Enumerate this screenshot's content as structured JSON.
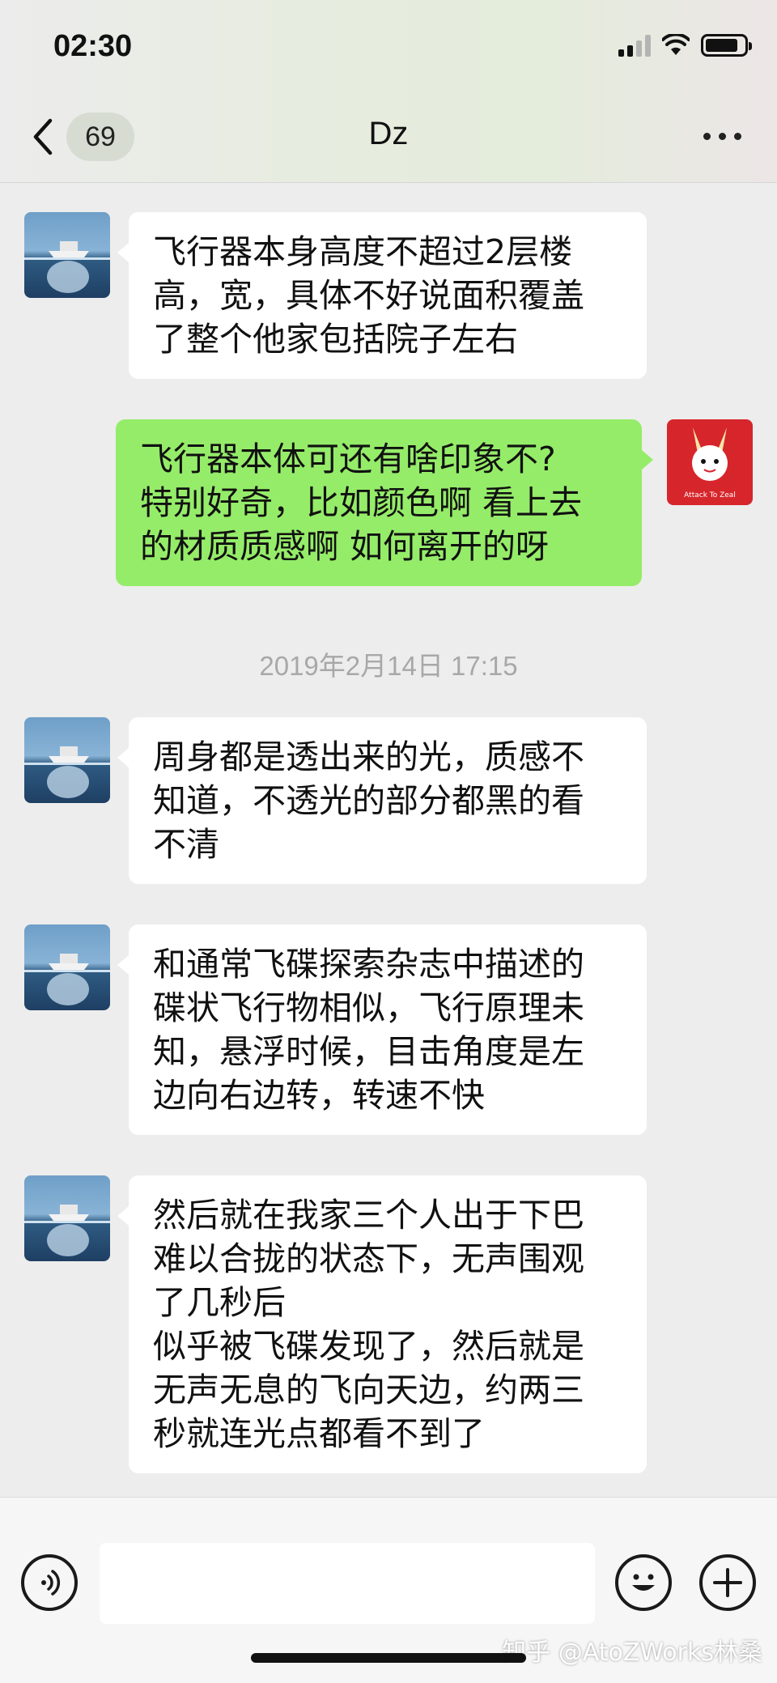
{
  "status_bar": {
    "time": "02:30"
  },
  "nav": {
    "unread_count": "69",
    "title": "Dz"
  },
  "messages": [
    {
      "side": "left",
      "text": "飞行器本身高度不超过2层楼\n高，宽，具体不好说面积覆盖\n了整个他家包括院子左右"
    },
    {
      "side": "right",
      "text": "飞行器本体可还有啥印象不?\n特别好奇，比如颜色啊 看上去\n的材质质感啊 如何离开的呀"
    },
    {
      "side": "left",
      "text": "周身都是透出来的光，质感不\n知道，不透光的部分都黑的看\n不清"
    },
    {
      "side": "left",
      "text": "和通常飞碟探索杂志中描述的\n碟状飞行物相似，飞行原理未\n知，悬浮时候，目击角度是左\n边向右边转，转速不快"
    },
    {
      "side": "left",
      "text": "然后就在我家三个人出于下巴\n难以合拢的状态下，无声围观\n了几秒后\n似乎被飞碟发现了，然后就是\n无声无息的飞向天边，约两三\n秒就连光点都看不到了"
    }
  ],
  "timestamp": "2019年2月14日 17:15",
  "avatar_right_caption": "Attack To Zeal",
  "input": {
    "value": ""
  },
  "watermark": "知乎 @AtoZWorks林桑",
  "colors": {
    "bubble_self": "#95ec69",
    "bubble_other": "#ffffff",
    "background": "#ededed"
  }
}
